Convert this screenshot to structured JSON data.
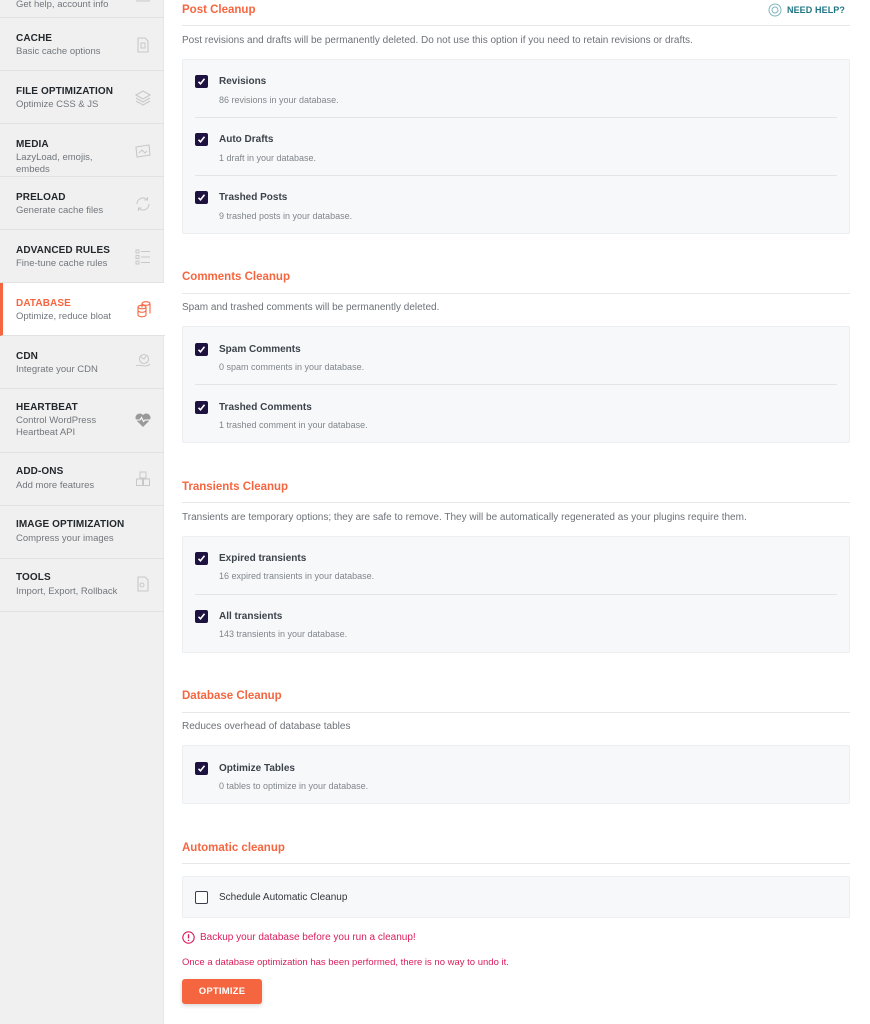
{
  "sidebar": {
    "partial_top_sub": "Get help, account info",
    "items": [
      {
        "title": "CACHE",
        "sub": "Basic cache options",
        "icon": "document-icon",
        "active": false
      },
      {
        "title": "FILE OPTIMIZATION",
        "sub": "Optimize CSS & JS",
        "icon": "layers-icon",
        "active": false
      },
      {
        "title": "MEDIA",
        "sub": "LazyLoad, emojis, embeds",
        "icon": "media-icon",
        "active": false
      },
      {
        "title": "PRELOAD",
        "sub": "Generate cache files",
        "icon": "refresh-icon",
        "active": false
      },
      {
        "title": "ADVANCED RULES",
        "sub": "Fine-tune cache rules",
        "icon": "checklist-icon",
        "active": false
      },
      {
        "title": "DATABASE",
        "sub": "Optimize, reduce bloat",
        "icon": "database-icon",
        "active": true
      },
      {
        "title": "CDN",
        "sub": "Integrate your CDN",
        "icon": "globe-hand-icon",
        "active": false
      },
      {
        "title": "HEARTBEAT",
        "sub": "Control WordPress Heartbeat API",
        "icon": "heartbeat-icon",
        "active": false
      },
      {
        "title": "ADD-ONS",
        "sub": "Add more features",
        "icon": "cubes-icon",
        "active": false
      },
      {
        "title": "IMAGE OPTIMIZATION",
        "sub": "Compress your images",
        "icon": "",
        "active": false
      },
      {
        "title": "TOOLS",
        "sub": "Import, Export, Rollback",
        "icon": "file-gear-icon",
        "active": false
      }
    ]
  },
  "help": {
    "label": "NEED HELP?",
    "icon": "lifebuoy-icon"
  },
  "sections": {
    "post": {
      "title": "Post Cleanup",
      "desc": "Post revisions and drafts will be permanently deleted. Do not use this option if you need to retain revisions or drafts.",
      "options": [
        {
          "label": "Revisions",
          "desc": "86 revisions in your database.",
          "checked": true
        },
        {
          "label": "Auto Drafts",
          "desc": "1 draft in your database.",
          "checked": true
        },
        {
          "label": "Trashed Posts",
          "desc": "9 trashed posts in your database.",
          "checked": true
        }
      ]
    },
    "comments": {
      "title": "Comments Cleanup",
      "desc": "Spam and trashed comments will be permanently deleted.",
      "options": [
        {
          "label": "Spam Comments",
          "desc": "0 spam comments in your database.",
          "checked": true
        },
        {
          "label": "Trashed Comments",
          "desc": "1 trashed comment in your database.",
          "checked": true
        }
      ]
    },
    "transients": {
      "title": "Transients Cleanup",
      "desc": "Transients are temporary options; they are safe to remove. They will be automatically regenerated as your plugins require them.",
      "options": [
        {
          "label": "Expired transients",
          "desc": "16 expired transients in your database.",
          "checked": true
        },
        {
          "label": "All transients",
          "desc": "143 transients in your database.",
          "checked": true
        }
      ]
    },
    "database": {
      "title": "Database Cleanup",
      "desc": "Reduces overhead of database tables",
      "options": [
        {
          "label": "Optimize Tables",
          "desc": "0 tables to optimize in your database.",
          "checked": true
        }
      ]
    },
    "automatic": {
      "title": "Automatic cleanup",
      "options": [
        {
          "label": "Schedule Automatic Cleanup",
          "checked": false
        }
      ]
    }
  },
  "warning": {
    "line1": "Backup your database before you run a cleanup!",
    "line2": "Once a database optimization has been performed, there is no way to undo it."
  },
  "optimize_button": "OPTIMIZE",
  "colors": {
    "accent": "#f56640",
    "checkbox": "#1e1340",
    "warning": "#d91e5b",
    "help": "#207583"
  }
}
